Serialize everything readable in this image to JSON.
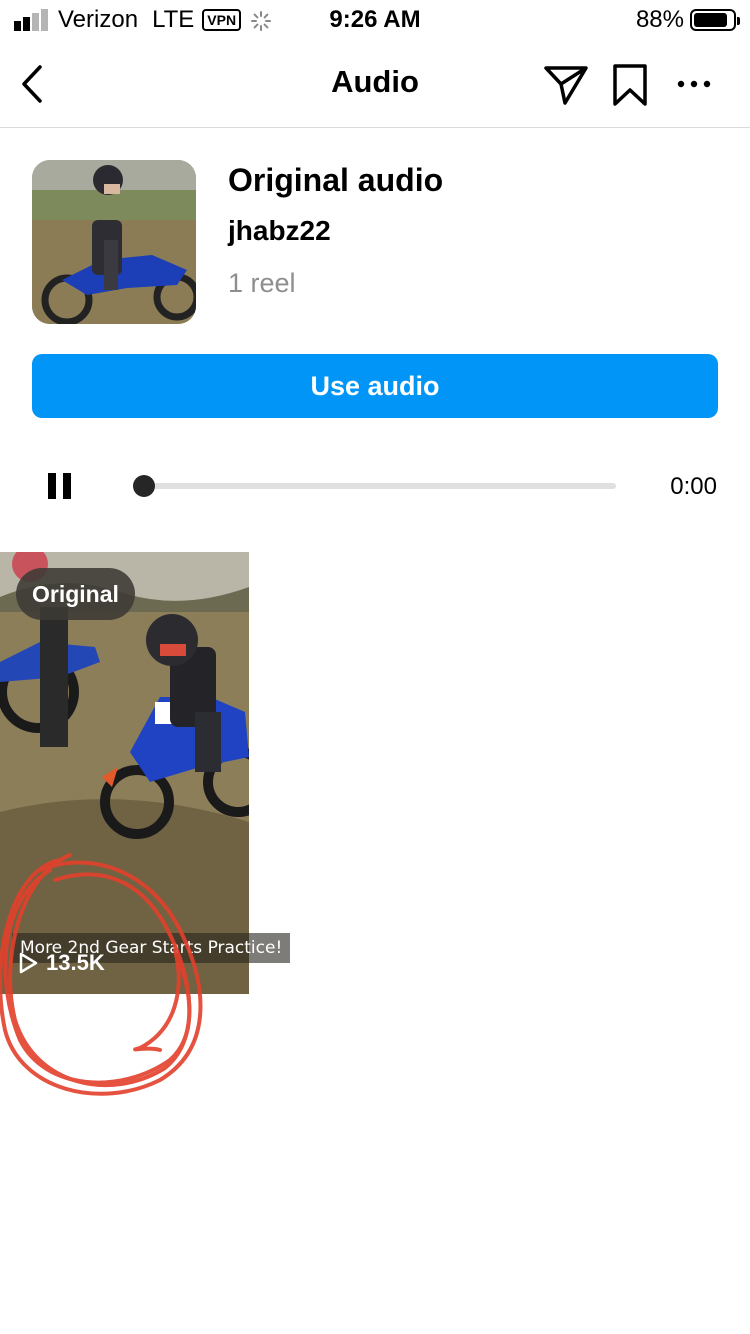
{
  "status_bar": {
    "carrier": "Verizon",
    "network": "LTE",
    "vpn": "VPN",
    "time": "9:26 AM",
    "battery": "88%",
    "battery_level": 0.88
  },
  "nav": {
    "title": "Audio",
    "icons": [
      "back-chevron-icon",
      "send-icon",
      "bookmark-icon",
      "more-icon"
    ]
  },
  "audio": {
    "title": "Original audio",
    "username": "jhabz22",
    "reel_count": "1 reel",
    "use_button": "Use audio"
  },
  "player": {
    "time": "0:00",
    "progress": 0.0
  },
  "reels": [
    {
      "badge": "Original",
      "caption": "More 2nd Gear Starts Practice!",
      "plays": "13.5K"
    }
  ],
  "colors": {
    "accent": "#0095f6",
    "annotation": "#e3402b"
  }
}
